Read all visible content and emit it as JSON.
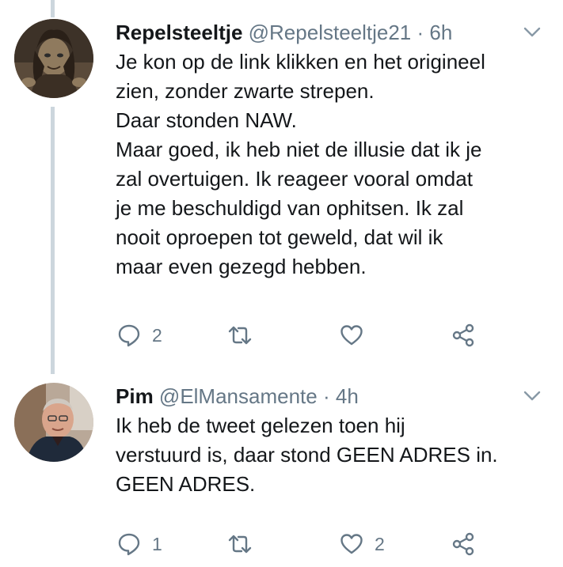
{
  "tweets": [
    {
      "name": "Repelsteeltje",
      "handle": "@Repelsteeltje21",
      "separator": "·",
      "time": "6h",
      "text": "Je kon op de link klikken en het origineel\nzien, zonder zwarte strepen.\nDaar stonden NAW.\nMaar goed, ik heb niet de illusie dat ik je\nzal overtuigen. Ik reageer vooral omdat\nje me beschuldigd van ophitsen. Ik zal\nnooit oproepen tot geweld, dat wil ik\nmaar even gezegd hebben.",
      "reply_count": "2",
      "retweet_count": "",
      "like_count": ""
    },
    {
      "name": "Pim",
      "handle": "@ElMansamente",
      "separator": "·",
      "time": "4h",
      "text": "Ik heb de tweet gelezen toen hij\nverstuurd is, daar stond GEEN ADRES in.\nGEEN ADRES.",
      "reply_count": "1",
      "retweet_count": "",
      "like_count": "2"
    }
  ],
  "icons": {
    "reply": "reply-icon",
    "retweet": "retweet-icon",
    "like": "heart-icon",
    "share": "share-icon",
    "menu": "chevron-down-icon"
  },
  "colors": {
    "icon": "#657786",
    "thread_line": "#ccd6dd",
    "text": "#14171a"
  }
}
